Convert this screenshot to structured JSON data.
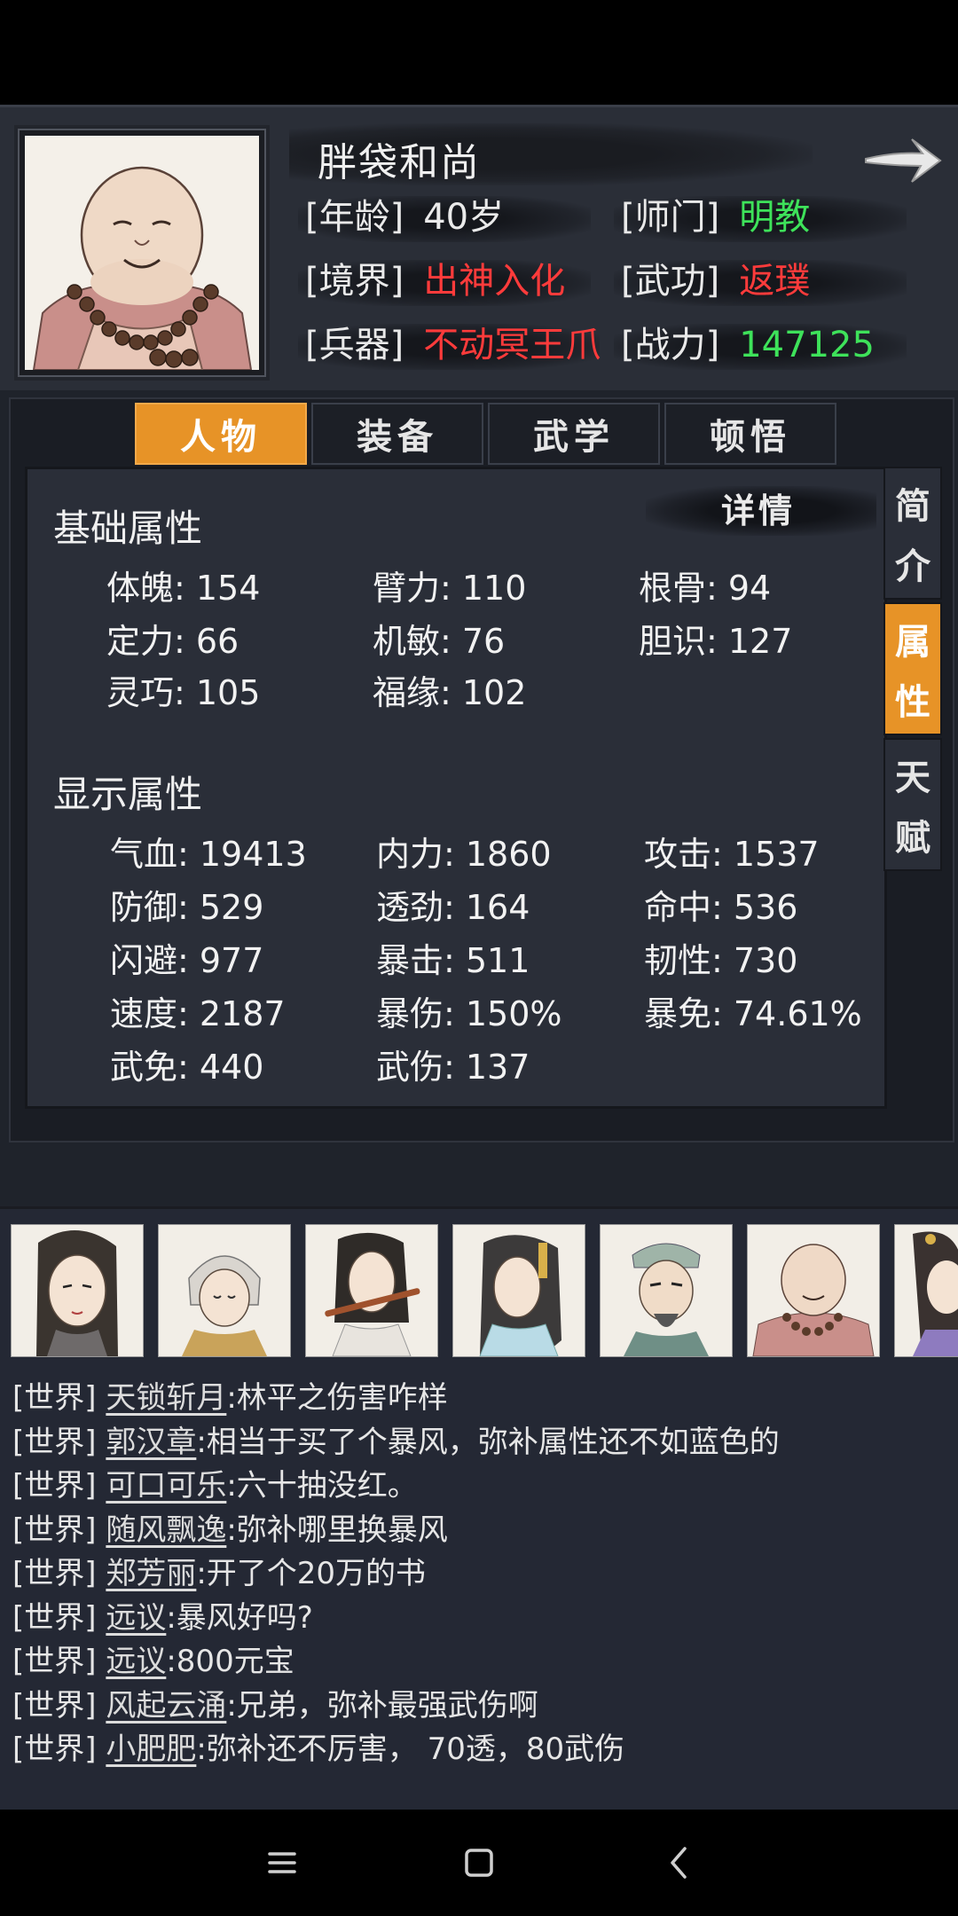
{
  "character": {
    "name": "胖袋和尚",
    "rows": [
      {
        "label1": "[年龄]",
        "value1": "40岁",
        "color1": "#eaeaea",
        "label2": "[师门]",
        "value2": "明教",
        "color2": "#3ee25a"
      },
      {
        "label1": "[境界]",
        "value1": "出神入化",
        "color1": "#ff3b3b",
        "label2": "[武功]",
        "value2": "返璞",
        "color2": "#ff3b3b"
      },
      {
        "label1": "[兵器]",
        "value1": "不动冥王爪",
        "color1": "#ff3b3b",
        "label2": "[战力]",
        "value2": "147125",
        "color2": "#3ee25a"
      }
    ]
  },
  "tabs": [
    {
      "label": "人物",
      "active": true
    },
    {
      "label": "装备",
      "active": false
    },
    {
      "label": "武学",
      "active": false
    },
    {
      "label": "顿悟",
      "active": false
    }
  ],
  "side_tabs": [
    {
      "chars": [
        "简",
        "介"
      ],
      "active": false
    },
    {
      "chars": [
        "属",
        "性"
      ],
      "active": true
    },
    {
      "chars": [
        "天",
        "赋"
      ],
      "active": false
    }
  ],
  "detail_label": "详情",
  "basic": {
    "title": "基础属性",
    "stats": [
      [
        "体魄: 154",
        "臂力: 110",
        "根骨: 94"
      ],
      [
        "定力: 66",
        "机敏: 76",
        "胆识: 127"
      ],
      [
        "灵巧: 105",
        "福缘: 102",
        ""
      ]
    ]
  },
  "display": {
    "title": "显示属性",
    "stats": [
      [
        "气血: 19413",
        "内力: 1860",
        "攻击: 1537"
      ],
      [
        "防御: 529",
        "透劲: 164",
        "命中: 536"
      ],
      [
        "闪避: 977",
        "暴击: 511",
        "韧性: 730"
      ],
      [
        "速度: 2187",
        "暴伤: 150%",
        "暴免: 74.61%"
      ],
      [
        "武免: 440",
        "武伤: 137",
        ""
      ]
    ]
  },
  "chat": [
    {
      "channel": "[世界]",
      "player": "天锁斩月",
      "message": ":林平之伤害咋样"
    },
    {
      "channel": "[世界]",
      "player": "郭汉章",
      "message": ":相当于买了个暴风，弥补属性还不如蓝色的"
    },
    {
      "channel": "[世界]",
      "player": "可口可乐",
      "message": ":六十抽没红。"
    },
    {
      "channel": "[世界]",
      "player": "随风飘逸",
      "message": ":弥补哪里换暴风"
    },
    {
      "channel": "[世界]",
      "player": "郑芳丽",
      "message": ":开了个20万的书"
    },
    {
      "channel": "[世界]",
      "player": "远议",
      "message": ":暴风好吗?"
    },
    {
      "channel": "[世界]",
      "player": "远议",
      "message": ":800元宝"
    },
    {
      "channel": "[世界]",
      "player": "风起云涌",
      "message": ":兄弟，弥补最强武伤啊"
    },
    {
      "channel": "[世界]",
      "player": "小肥肥",
      "message": ":弥补还不厉害， 70透，80武伤"
    }
  ],
  "colors": {
    "accent": "#e79327",
    "red": "#ff3b3b",
    "green": "#3ee25a",
    "panel": "#2a2e38"
  },
  "icons": {
    "next": "arrow-right-icon",
    "nav": [
      "menu-icon",
      "home-icon",
      "back-icon"
    ]
  }
}
